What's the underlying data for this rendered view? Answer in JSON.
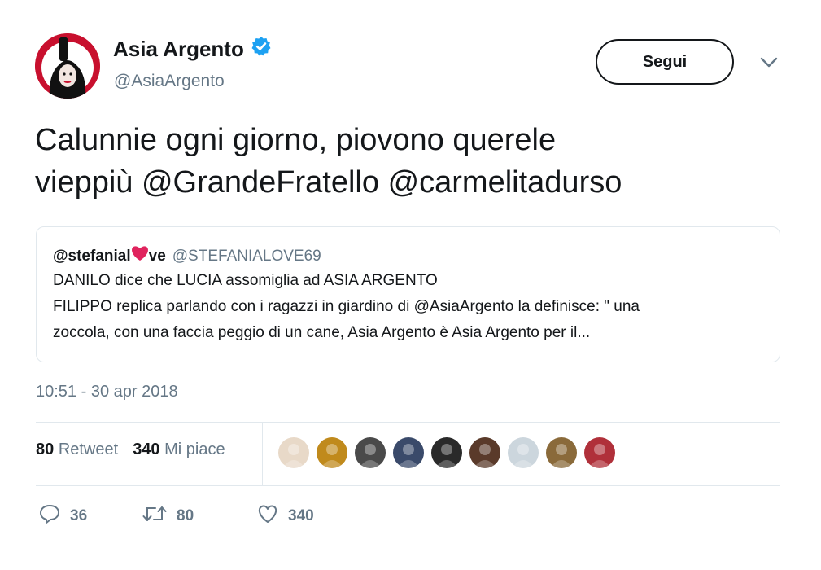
{
  "author": {
    "name": "Asia Argento",
    "handle": "@AsiaArgento",
    "verified": true,
    "avatar_color": "#c8102e"
  },
  "follow_label": "Segui",
  "tweet": {
    "line1": "Calunnie ogni giorno, piovono querele",
    "line2": "vieppiù @GrandeFratello @carmelitadurso"
  },
  "quoted": {
    "name_part1": "@stefanial",
    "name_emoji": "heart-emoji",
    "name_part2": "ve",
    "handle": "@STEFANIALOVE69",
    "lines": [
      "DANILO dice che LUCIA assomiglia ad ASIA ARGENTO",
      "FILIPPO replica parlando con i ragazzi in giardino di @AsiaArgento la definisce: \" una",
      "zoccola, con una faccia peggio di un cane, Asia Argento è Asia Argento per il..."
    ]
  },
  "timestamp": "10:51 - 30 apr 2018",
  "stats": {
    "retweets": "80",
    "retweets_label": "Retweet",
    "likes": "340",
    "likes_label": "Mi piace"
  },
  "likers": [
    {
      "color": "#e8d9c8"
    },
    {
      "color": "#c08a1c"
    },
    {
      "color": "#4a4a4a"
    },
    {
      "color": "#3a4a6a"
    },
    {
      "color": "#2a2a2a"
    },
    {
      "color": "#5a3a2a"
    },
    {
      "color": "#ccd6dd"
    },
    {
      "color": "#8a6a3a"
    },
    {
      "color": "#b0303a"
    }
  ],
  "actions": {
    "reply_count": "36",
    "retweet_count": "80",
    "like_count": "340"
  },
  "colors": {
    "verified_blue": "#1da1f2",
    "secondary_text": "#657786",
    "border": "#e1e8ed"
  }
}
